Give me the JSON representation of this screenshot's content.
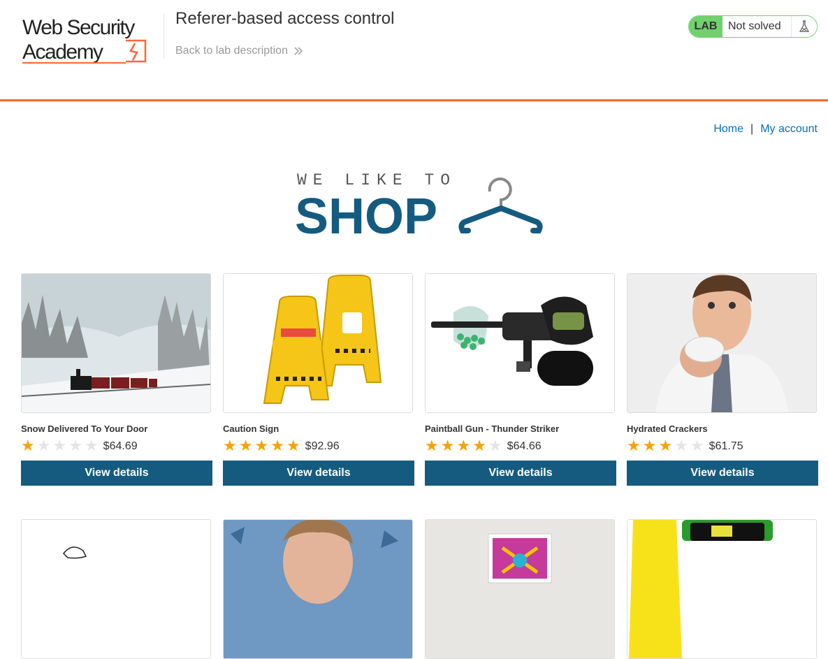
{
  "header": {
    "lab_title": "Referer-based access control",
    "back_link": "Back to lab description",
    "lab_badge": "LAB",
    "status": "Not solved",
    "logo_text_line1": "Web Security",
    "logo_text_line2": "Academy"
  },
  "nav": {
    "home": "Home",
    "separator": "|",
    "my_account": "My account"
  },
  "banner": {
    "line1": "WE LIKE TO",
    "line2": "SHOP"
  },
  "products": [
    {
      "name": "Snow Delivered To Your Door",
      "rating": 1,
      "price": "$64.69",
      "button": "View details",
      "image": "snowy-train"
    },
    {
      "name": "Caution Sign",
      "rating": 5,
      "price": "$92.96",
      "button": "View details",
      "image": "yellow-caution-signs"
    },
    {
      "name": "Paintball Gun - Thunder Striker",
      "rating": 4,
      "price": "$64.66",
      "button": "View details",
      "image": "paintball-gun"
    },
    {
      "name": "Hydrated Crackers",
      "rating": 3,
      "price": "$61.75",
      "button": "View details",
      "image": "man-eating-cracker"
    }
  ],
  "colors": {
    "accent_orange": "#ff6633",
    "button_blue": "#155b80",
    "link_blue": "#0071bc",
    "lab_green": "#70d16d",
    "star": "#f7a200"
  }
}
